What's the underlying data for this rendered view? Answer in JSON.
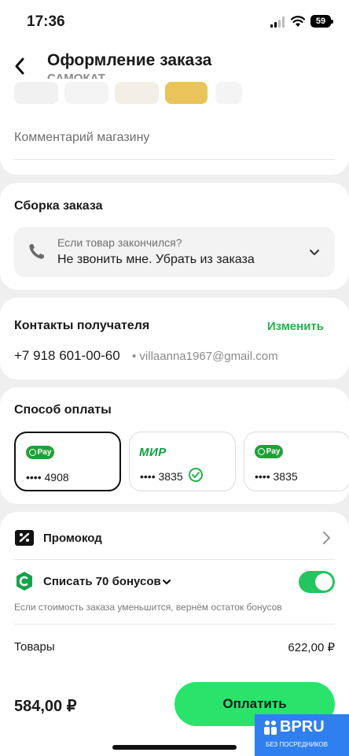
{
  "status_bar": {
    "time": "17:36",
    "battery": "59"
  },
  "header": {
    "title": "Оформление заказа",
    "subtitle": "САМОКАТ"
  },
  "comment": {
    "placeholder": "Комментарий магазину"
  },
  "assembly": {
    "title": "Сборка заказа",
    "question": "Если товар закончился?",
    "value": "Не звонить мне. Убрать из заказа"
  },
  "contacts": {
    "title": "Контакты получателя",
    "change_label": "Изменить",
    "phone": "+7 918 601-00-60",
    "email": "• villaanna1967@gmail.com"
  },
  "payment": {
    "title": "Способ оплаты",
    "cards": [
      {
        "brand": "Pay",
        "number": "•••• 4908",
        "selected": true
      },
      {
        "brand": "МИР",
        "number": "•••• 3835",
        "checked": true
      },
      {
        "brand": "Pay",
        "number": "•••• 3835"
      }
    ]
  },
  "promo": {
    "label": "Промокод"
  },
  "bonus": {
    "label": "Списать 70 бонусов",
    "enabled": true,
    "hint": "Если стоимость заказа уменьшится, вернём остаток бонусов"
  },
  "summary": {
    "goods_label": "Товары",
    "goods_value": "622,00 ₽"
  },
  "footer": {
    "total": "584,00 ₽",
    "pay_label": "Оплатить"
  },
  "watermark": {
    "name": "BPRU",
    "tagline": "БЕЗ ПОСРЕДНИКОВ"
  },
  "colors": {
    "accent": "#2ae36a",
    "link": "#23b14d",
    "sberpay": "#21a038",
    "mir": "#0f9f3f",
    "badge": "#2f7ff0"
  }
}
